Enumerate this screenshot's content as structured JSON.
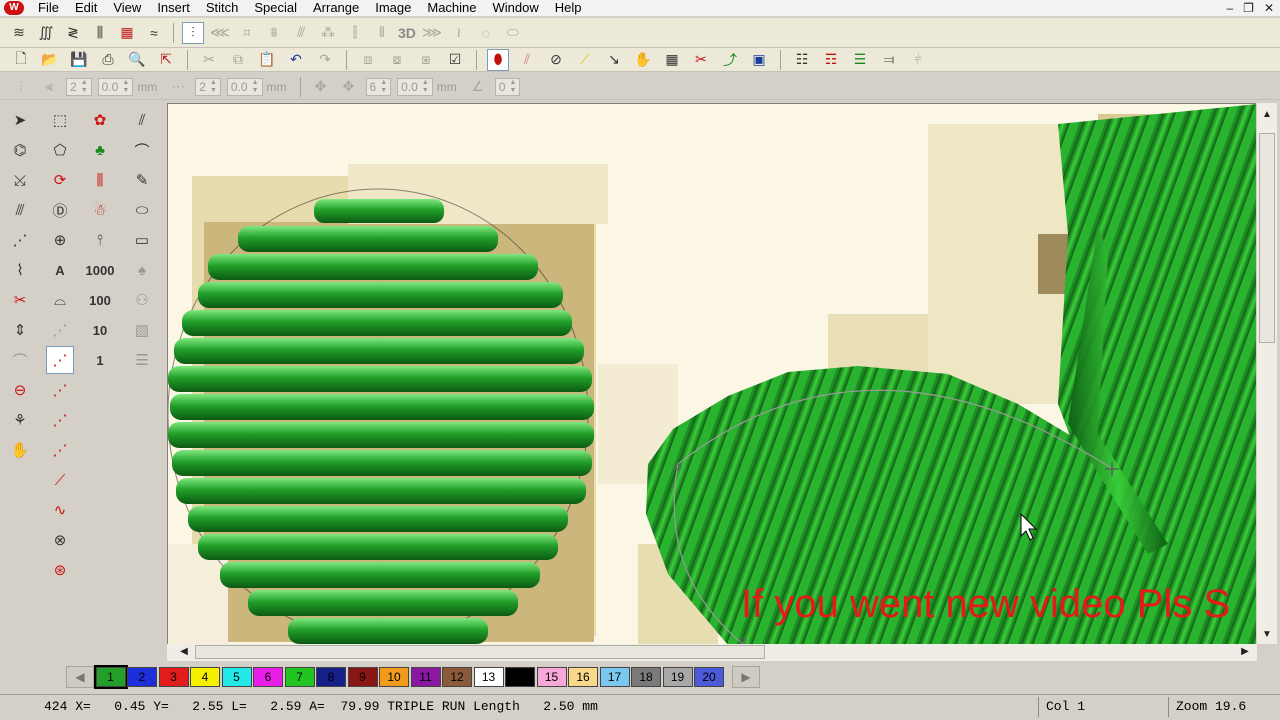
{
  "app": {
    "logo_letter": "W"
  },
  "menubar": {
    "items": [
      "File",
      "Edit",
      "View",
      "Insert",
      "Stitch",
      "Special",
      "Arrange",
      "Image",
      "Machine",
      "Window",
      "Help"
    ]
  },
  "window_controls": {
    "minimize": "–",
    "restore": "❐",
    "close": "✕"
  },
  "toolbar1": {
    "label_3d": "3D"
  },
  "toolbar3": {
    "spin1_value": "2",
    "spin2_value": "0.0",
    "unit1": "mm",
    "spin3_value": "2",
    "spin4_value": "0.0",
    "unit2": "mm",
    "spin5_value": "6",
    "spin6_value": "0.0",
    "unit3": "mm",
    "spin7_value": "0"
  },
  "toolbox": {
    "count_1000": "1000",
    "count_100": "100",
    "count_10": "10",
    "count_1": "1",
    "text_tool": "A"
  },
  "canvas": {
    "overlay_caption": "If you went new video Pls S",
    "thread_color": "#22a02a"
  },
  "palette": {
    "left_arrow": "◀",
    "right_arrow": "▶",
    "swatches": [
      {
        "label": "1",
        "color": "#22a02a",
        "text": "#000000"
      },
      {
        "label": "2",
        "color": "#1c2fd8",
        "text": "#000000"
      },
      {
        "label": "3",
        "color": "#e21b1b",
        "text": "#000000"
      },
      {
        "label": "4",
        "color": "#f4f000",
        "text": "#000000"
      },
      {
        "label": "5",
        "color": "#22e8e8",
        "text": "#000000"
      },
      {
        "label": "6",
        "color": "#e81ee8",
        "text": "#000000"
      },
      {
        "label": "7",
        "color": "#22c422",
        "text": "#000000"
      },
      {
        "label": "8",
        "color": "#15208a",
        "text": "#000000"
      },
      {
        "label": "9",
        "color": "#8a1515",
        "text": "#000000"
      },
      {
        "label": "10",
        "color": "#f29a1a",
        "text": "#000000"
      },
      {
        "label": "11",
        "color": "#8a18a0",
        "text": "#000000"
      },
      {
        "label": "12",
        "color": "#8a5a3a",
        "text": "#000000"
      },
      {
        "label": "13",
        "color": "#ffffff",
        "text": "#000000"
      },
      {
        "label": "14",
        "color": "#000000",
        "text": "#000000"
      },
      {
        "label": "15",
        "color": "#f7a8d8",
        "text": "#000000"
      },
      {
        "label": "16",
        "color": "#f9d88a",
        "text": "#000000"
      },
      {
        "label": "17",
        "color": "#7ac8f0",
        "text": "#000000"
      },
      {
        "label": "18",
        "color": "#7a7a7a",
        "text": "#000000"
      },
      {
        "label": "19",
        "color": "#a8a8a8",
        "text": "#000000"
      },
      {
        "label": "20",
        "color": "#4a5ad8",
        "text": "#000000"
      }
    ]
  },
  "statusbar": {
    "main": "424 X=   0.45 Y=   2.55 L=   2.59 A=  79.99 TRIPLE RUN Length   2.50 mm",
    "col": "Col 1",
    "zoom": "Zoom 19.6"
  }
}
